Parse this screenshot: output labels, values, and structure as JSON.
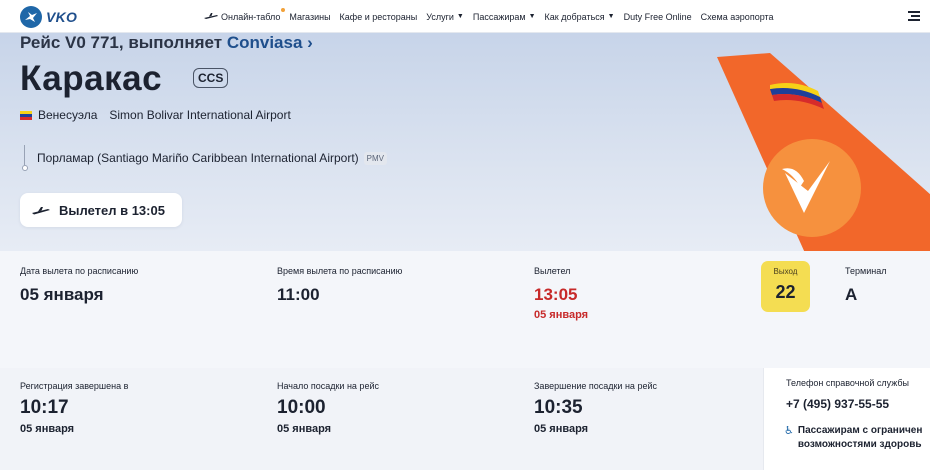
{
  "brand": {
    "logo_text": "VKO",
    "accent": "#1f67a8"
  },
  "nav": {
    "items": [
      {
        "label": "Онлайн-табло",
        "icon": "plane-icon",
        "has_dot": true
      },
      {
        "label": "Магазины"
      },
      {
        "label": "Кафе и рестораны"
      },
      {
        "label": "Услуги",
        "dropdown": true
      },
      {
        "label": "Пассажирам",
        "dropdown": true
      },
      {
        "label": "Как добраться",
        "dropdown": true
      },
      {
        "label": "Duty Free Online"
      },
      {
        "label": "Схема аэропорта"
      }
    ]
  },
  "flight": {
    "title_prefix": "Рейс V0 771, выполняет",
    "carrier": "Conviasa",
    "carrier_chevron": "›",
    "destination_city": "Каракас",
    "destination_code": "CCS",
    "country": "Венесуэла",
    "airport": "Simon Bolivar International Airport",
    "origin": "Порламар (Santiago Mariño Caribbean International Airport)",
    "origin_code": "PMV",
    "status": "Вылетел в 13:05"
  },
  "departure": {
    "scheduled_date_label": "Дата вылета по расписанию",
    "scheduled_date": "05 января",
    "scheduled_time_label": "Время вылета по расписанию",
    "scheduled_time": "11:00",
    "actual_label": "Вылетел",
    "actual_time": "13:05",
    "actual_date": "05 января",
    "gate_label": "Выход",
    "gate": "22",
    "terminal_label": "Терминал",
    "terminal": "A"
  },
  "boarding": {
    "checkin_label": "Регистрация завершена в",
    "checkin_time": "10:17",
    "checkin_date": "05 января",
    "board_start_label": "Начало посадки на рейс",
    "board_start_time": "10:00",
    "board_start_date": "05 января",
    "board_end_label": "Завершение посадки на рейс",
    "board_end_time": "10:35",
    "board_end_date": "05 января"
  },
  "help": {
    "phone_label": "Телефон справочной службы",
    "phone": "+7 (495) 937-55-55",
    "access_line1": "Пассажирам с ограничен",
    "access_line2": "возможностями здоровь"
  },
  "colors": {
    "status_red": "#c72a2a",
    "gate_yellow": "#f4dd52",
    "tail_orange": "#f2672a"
  }
}
